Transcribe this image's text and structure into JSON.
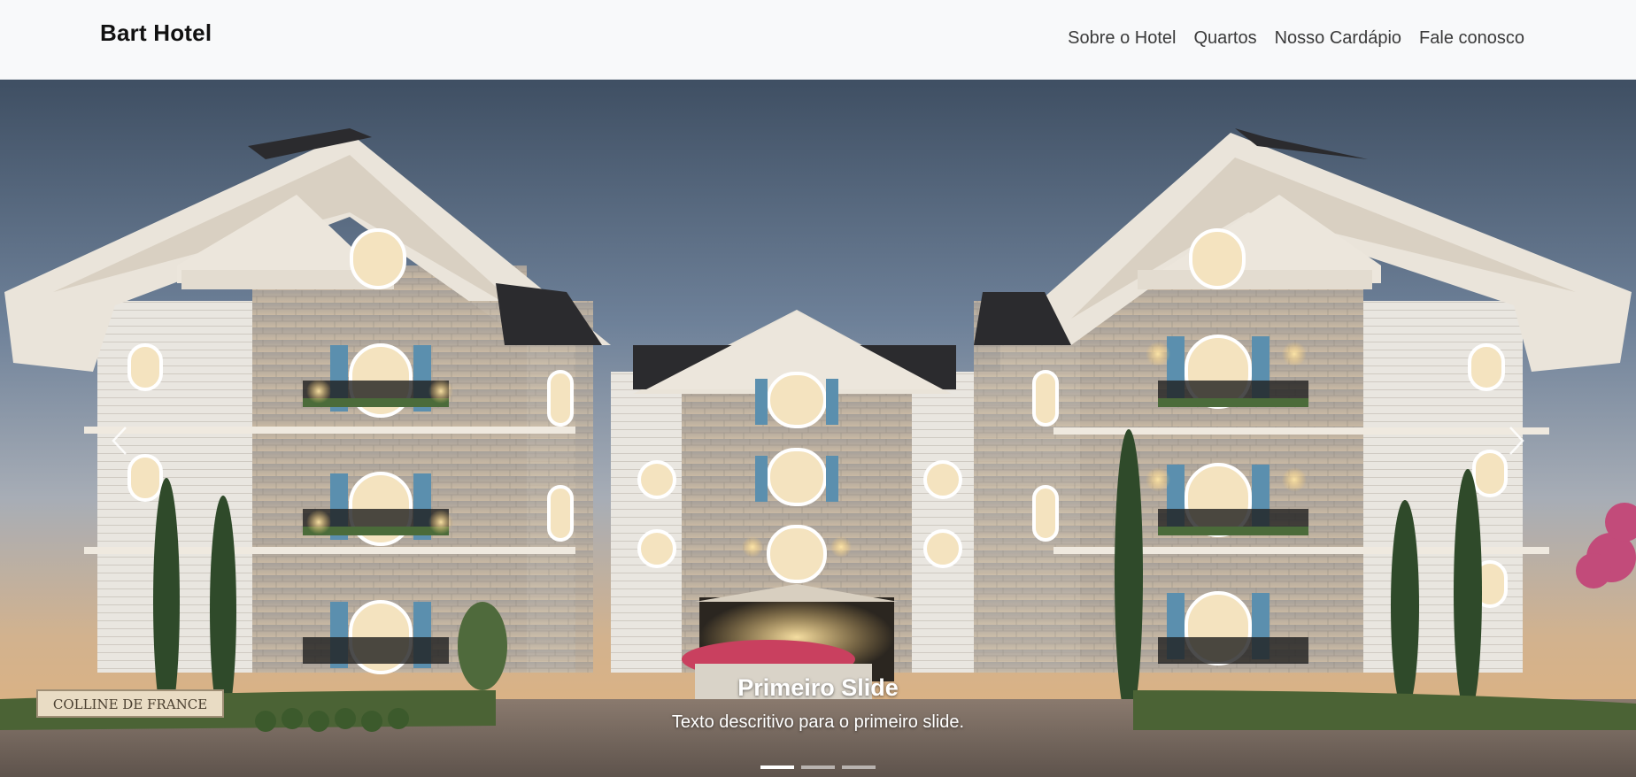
{
  "navbar": {
    "brand": "Bart Hotel",
    "links": [
      {
        "label": "Sobre o Hotel"
      },
      {
        "label": "Quartos"
      },
      {
        "label": "Nosso Cardápio"
      },
      {
        "label": "Fale conosco"
      }
    ]
  },
  "carousel": {
    "active_index": 0,
    "slide_count": 3,
    "slides": [
      {
        "title": "Primeiro Slide",
        "text": "Texto descritivo para o primeiro slide.",
        "sign": "COLLINE DE FRANCE"
      }
    ],
    "prev_icon": "chevron-left-icon",
    "next_icon": "chevron-right-icon"
  },
  "colors": {
    "navbar_bg": "#f8f9fa",
    "stone": "#b9b1a8",
    "shutter": "#5b8fae",
    "roof": "#2b2b2e",
    "light": "#ffd98a"
  }
}
